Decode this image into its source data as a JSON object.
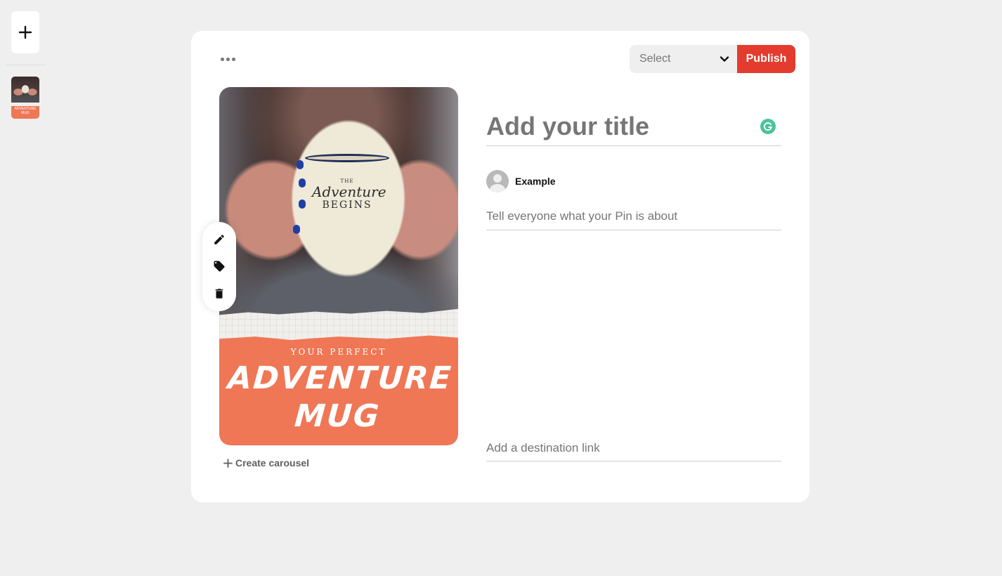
{
  "rail": {
    "add_label": "+",
    "thumbnail_text": "ADVENTURE MUG"
  },
  "toolbar": {
    "more_options": "more-options",
    "board_select_label": "Select",
    "publish_label": "Publish"
  },
  "pin_image": {
    "mug_line1": "THE",
    "mug_line2": "Adventure",
    "mug_line3": "BEGINS",
    "overlay_subtitle": "YOUR PERFECT",
    "overlay_title_line1": "ADVENTURE",
    "overlay_title_line2": "MUG",
    "colors": {
      "band": "#ef7755"
    }
  },
  "image_tools": [
    {
      "name": "edit",
      "icon": "pencil-icon"
    },
    {
      "name": "tag",
      "icon": "tag-icon"
    },
    {
      "name": "delete",
      "icon": "trash-icon"
    }
  ],
  "carousel": {
    "label": "Create carousel"
  },
  "form": {
    "title_placeholder": "Add your title",
    "title_value": "",
    "user_name": "Example",
    "description_placeholder": "Tell everyone what your Pin is about",
    "description_value": "",
    "link_placeholder": "Add a destination link",
    "link_value": ""
  },
  "colors": {
    "publish": "#e33b2e",
    "grammarly": "#4cc39a",
    "background": "#efefef"
  }
}
